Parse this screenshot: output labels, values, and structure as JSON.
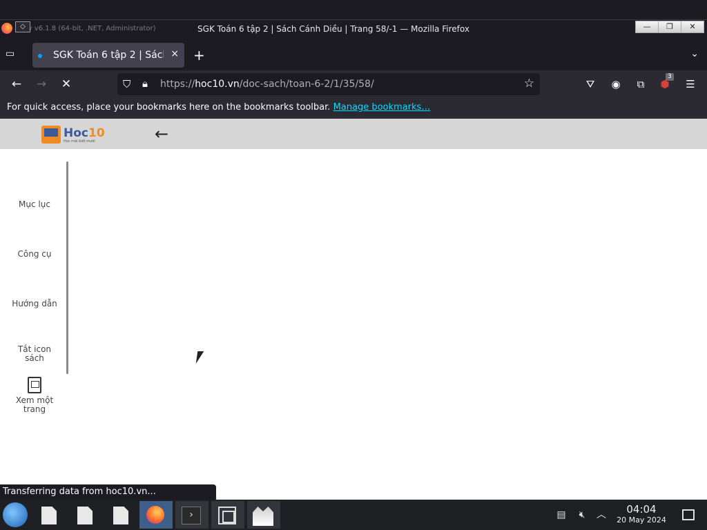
{
  "window": {
    "app_text": "..py v6.1.8 (64-bit, .NET, Administrator)",
    "title": "SGK Toán 6 tập 2 | Sách Cánh Diều | Trang 58/-1 — Mozilla Firefox",
    "controls": [
      "—",
      "❐",
      "✕"
    ]
  },
  "tabs": [
    {
      "title": "SGK Toán 6 tập 2 | Sách Cánh Diều",
      "close": "×"
    }
  ],
  "toolbar": {
    "back": "←",
    "forward": "→",
    "stop": "✕",
    "url_domain": "hoc10.vn",
    "url_prefix": "https://",
    "url_path": "/doc-sach/toan-6-2/1/35/58/",
    "extension_badge": "3"
  },
  "bookmarks_bar": {
    "text": "For quick access, place your bookmarks here on the bookmarks toolbar.",
    "link": "Manage bookmarks…"
  },
  "page": {
    "logo_text": "Hoc",
    "logo_num": "10",
    "logo_tagline": "Học mãi biết mười",
    "back": "←",
    "sidebar": {
      "items": [
        {
          "label": "Mục lục"
        },
        {
          "label": "Công cụ"
        },
        {
          "label": "Hướng dẫn"
        },
        {
          "label_line1": "Tắt icon",
          "label_line2": "sách"
        },
        {
          "label_line1": "Xem một",
          "label_line2": "trang"
        }
      ]
    }
  },
  "status": {
    "text": "Transferring data from hoc10.vn..."
  },
  "taskbar": {
    "time": "04:04",
    "date": "20 May 2024"
  },
  "colors": {
    "chrome_dark": "#1c1b22",
    "chrome_toolbar": "#2b2a33",
    "link": "#00ddff",
    "page_header": "#d6d6d6",
    "logo_orange": "#f08a24",
    "logo_blue": "#3b5a9a"
  }
}
